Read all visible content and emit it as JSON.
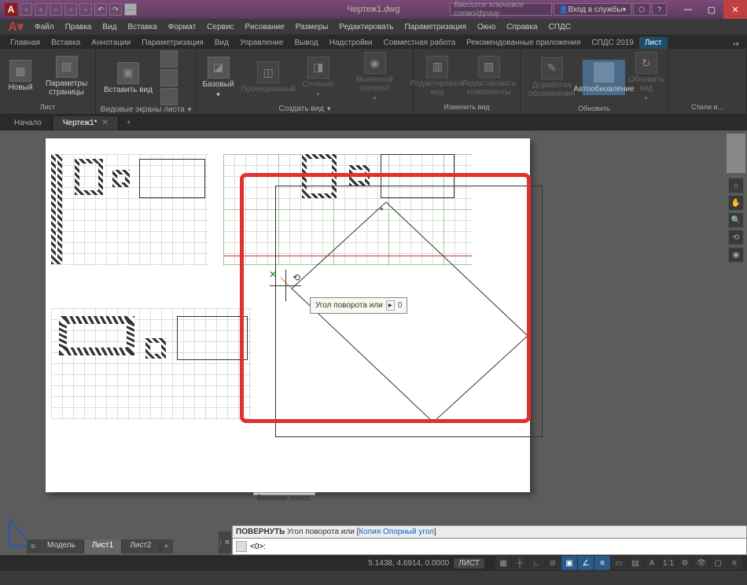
{
  "title": "Чертеж1.dwg",
  "search_placeholder": "Введите ключевое слово/фразу",
  "account": {
    "signin": "Вход в службы"
  },
  "menus": [
    "Файл",
    "Правка",
    "Вид",
    "Вставка",
    "Формат",
    "Сервис",
    "Рисование",
    "Размеры",
    "Редактировать",
    "Параметризация",
    "Окно",
    "Справка",
    "СПДС"
  ],
  "ribbon_tabs": [
    "Главная",
    "Вставка",
    "Аннотации",
    "Параметризация",
    "Вид",
    "Управление",
    "Вывод",
    "Надстройки",
    "Совместная работа",
    "Рекомендованные приложения",
    "СПДС 2019"
  ],
  "ribbon": {
    "p1": {
      "title": "Лист",
      "b1": "Новый",
      "b2": "Параметры страницы"
    },
    "p2": {
      "title": "Видовые экраны листа",
      "b1": "Вставить вид"
    },
    "p3": {
      "title": "Создать вид",
      "b1": "Базовый",
      "b2": "Проекционный",
      "b3": "Сечение",
      "b4": "Выносной элемент"
    },
    "p4": {
      "title": "Изменить вид",
      "b1": "Редактировать вид",
      "b2": "Редактировать компоненты"
    },
    "p5": {
      "title": "Обновить",
      "b1": "Доработка обозначения",
      "b2": "Автообновление",
      "b3": "Обновить вид"
    },
    "p6": {
      "title": "Стили и..."
    }
  },
  "doc_tabs": {
    "t1": "Начало",
    "t2": "Чертеж1*"
  },
  "tooltip": {
    "text": "Угол поворота или",
    "value": "0"
  },
  "basepoint": "Базовая точка:",
  "cmd": {
    "hist": "ПОВЕРНУТЬ Угол поворота или [Копия Опорный угол]",
    "hist_l1": "Копия",
    "hist_l2": "Опорный угол",
    "prompt": "<0>:"
  },
  "layout_tabs": {
    "t1": "Модель",
    "t2": "Лист1",
    "t3": "Лист2"
  },
  "status": {
    "coords": "5.1438, 4.6914, 0.0000",
    "mode": "ЛИСТ"
  }
}
